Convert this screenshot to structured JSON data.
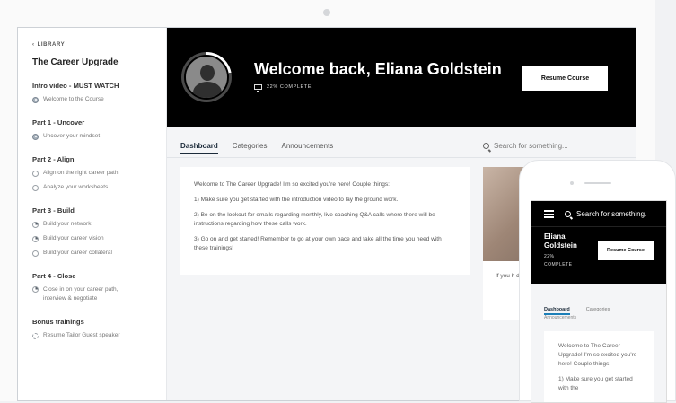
{
  "sidebar": {
    "back_label": "LIBRARY",
    "course_title": "The Career Upgrade",
    "sections": [
      {
        "title": "Intro video - MUST WATCH",
        "lessons": [
          {
            "label": "Welcome to the Course",
            "status": "done"
          }
        ]
      },
      {
        "title": "Part 1 - Uncover",
        "lessons": [
          {
            "label": "Uncover your mindset",
            "status": "done"
          }
        ]
      },
      {
        "title": "Part 2 - Align",
        "lessons": [
          {
            "label": "Align on the right career path",
            "status": "todo"
          },
          {
            "label": "Analyze your worksheets",
            "status": "video"
          }
        ]
      },
      {
        "title": "Part 3 - Build",
        "lessons": [
          {
            "label": "Build your network",
            "status": "partial"
          },
          {
            "label": "Build your career vision",
            "status": "partial"
          },
          {
            "label": "Build your career collateral",
            "status": "video"
          }
        ]
      },
      {
        "title": "Part 4 - Close",
        "lessons": [
          {
            "label": "Close in on your career path, interview & negotiate",
            "status": "partial"
          }
        ]
      },
      {
        "title": "Bonus trainings",
        "lessons": [
          {
            "label": "Resume Tailor Guest speaker",
            "status": "loading"
          }
        ]
      }
    ]
  },
  "hero": {
    "welcome": "Welcome back, Eliana Goldstein",
    "progress_label": "22% COMPLETE",
    "progress_fraction": 0.22,
    "resume_button": "Resume Course"
  },
  "tabs": [
    {
      "label": "Dashboard",
      "active": true
    },
    {
      "label": "Categories",
      "active": false
    },
    {
      "label": "Announcements",
      "active": false
    }
  ],
  "search": {
    "placeholder": "Search for something..."
  },
  "intro_card": {
    "paragraphs": [
      "Welcome to The Career Upgrade! I'm so excited you're here! Couple things:",
      "1) Make sure you get started with the introduction video to lay the ground work.",
      "2) Be on the lookout for emails regarding monthly, live coaching Q&A calls where there will be instructions regarding how these calls work.",
      "3) Go on and get started! Remember to go at your own pace and take all the time you need with these trainings!"
    ]
  },
  "side_card": {
    "text": "If you h difficult info@el"
  },
  "phone": {
    "search": "Search for something.",
    "name": "Eliana Goldstein",
    "progress": "22% COMPLETE",
    "resume_button": "Resume Course",
    "tabs": [
      "Dashboard",
      "Categories"
    ],
    "tab3": "Announcements",
    "card_paragraphs": [
      "Welcome to The Career Upgrade! I'm so excited you're here! Couple things:",
      "1) Make sure you get started with the"
    ]
  }
}
